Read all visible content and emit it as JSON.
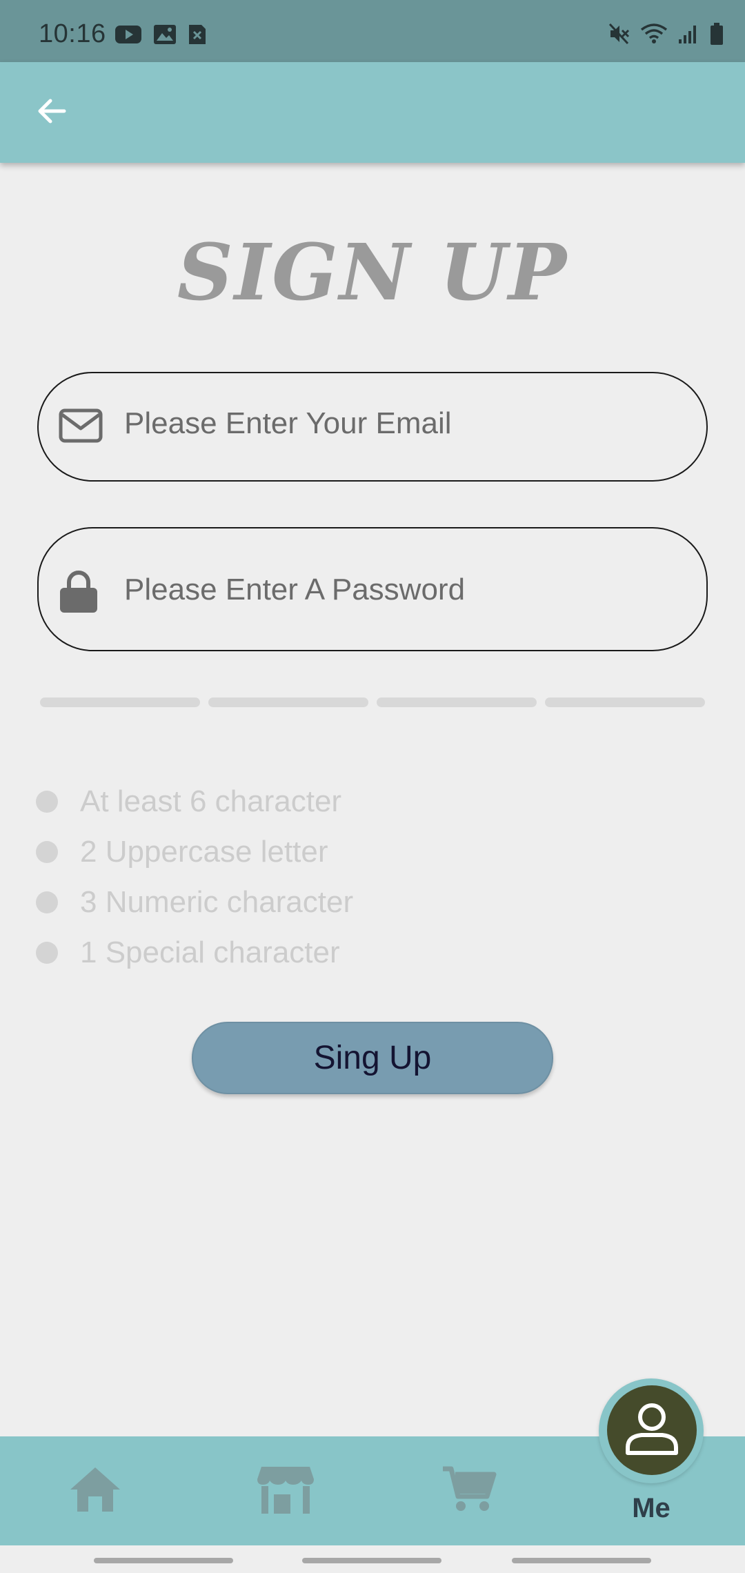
{
  "status_bar": {
    "time": "10:16",
    "left_icons": [
      "youtube-icon",
      "gallery-icon",
      "sim-error-icon"
    ],
    "right_icons": [
      "mute-icon",
      "wifi-icon",
      "signal-icon",
      "battery-icon"
    ]
  },
  "app_bar": {
    "back_icon": "arrow-left-icon"
  },
  "page": {
    "title": "SIGN UP"
  },
  "form": {
    "email": {
      "placeholder": "Please Enter Your Email",
      "icon": "mail-icon"
    },
    "password": {
      "placeholder": "Please Enter A Password",
      "icon": "lock-icon"
    },
    "strength_segments": 4,
    "rules": [
      "At least 6 character",
      "2 Uppercase letter",
      "3 Numeric character",
      "1 Special character"
    ],
    "submit_label": "Sing Up"
  },
  "bottom_nav": {
    "items": [
      {
        "icon": "home-icon",
        "label": ""
      },
      {
        "icon": "store-icon",
        "label": ""
      },
      {
        "icon": "cart-icon",
        "label": ""
      },
      {
        "icon": "person-icon",
        "label": "Me"
      }
    ],
    "active": "Me"
  },
  "colors": {
    "app_bar": "#8bc5c8",
    "status_bar": "#6a9598",
    "button": "#789cb0",
    "fab": "#454b2b",
    "background": "#eeeeee"
  }
}
